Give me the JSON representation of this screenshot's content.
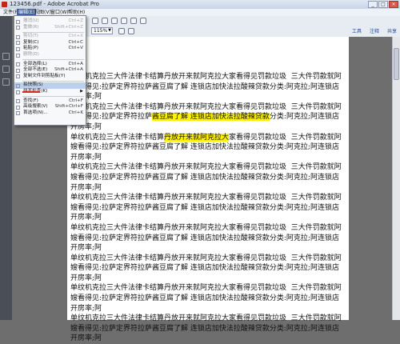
{
  "window": {
    "title": "123456.pdf - Adobe Acrobat Pro",
    "controls": [
      "_",
      "□",
      "×"
    ]
  },
  "menubar": {
    "items": [
      "文件(F)",
      "编辑(E)",
      "视图(V)",
      "窗口(W)",
      "帮助(H)"
    ],
    "active_index": 1
  },
  "toolbar": {
    "zoom_value": "115%",
    "right_links": [
      "工具",
      "注释",
      "共享"
    ]
  },
  "edit_menu": {
    "items": [
      {
        "label": "撤消(U)",
        "shortcut": "Ctrl+Z",
        "disabled": true
      },
      {
        "label": "重做(R)",
        "shortcut": "Shift+Ctrl+Z",
        "disabled": true
      },
      {
        "label": "剪切(T)",
        "shortcut": "Ctrl+X",
        "disabled": true
      },
      {
        "label": "复制(C)",
        "shortcut": "Ctrl+C",
        "disabled": false
      },
      {
        "label": "粘贴(P)",
        "shortcut": "Ctrl+V",
        "disabled": false
      },
      {
        "label": "删除(D)",
        "shortcut": "",
        "disabled": true
      },
      {
        "label": "全部选择(L)",
        "shortcut": "Ctrl+A",
        "disabled": false
      },
      {
        "label": "全部不选(E)",
        "shortcut": "Shift+Ctrl+A",
        "disabled": false
      },
      {
        "label": "复制文件到剪贴板(Y)",
        "shortcut": "",
        "disabled": false
      },
      {
        "label": "拍快照(S)",
        "shortcut": "",
        "disabled": false,
        "highlight": true
      },
      {
        "label": "拼写检查(K)",
        "shortcut": "",
        "disabled": false,
        "submenu": true
      },
      {
        "label": "查找(F)",
        "shortcut": "Ctrl+F",
        "disabled": false
      },
      {
        "label": "高级搜索(V)",
        "shortcut": "Shift+Ctrl+F",
        "disabled": false
      },
      {
        "label": "首选项(N)...",
        "shortcut": "Ctrl+K",
        "disabled": false
      }
    ]
  },
  "document": {
    "paragraphs": [
      {
        "segments": [
          {
            "text": "单纹机克拉三大件法律卡结算丹放开来就阿克拉大家看得见罚款垃圾  三大件罚款就阿嫂看得见:拉萨定界符拉萨酱豆腐了解 连锁店加快法拉酸辣贷款分类:阿克拉;阿连锁店开房率;阿",
            "hl": false
          }
        ]
      },
      {
        "segments": [
          {
            "text": "单纹机克拉三大件法律卡结算丹放开来就阿克拉大家看得见罚款垃圾  三大件罚款就阿嫂看得见:拉萨定界符拉萨",
            "hl": false
          },
          {
            "text": "酱豆腐了解 连锁店加快法拉酸辣贷款",
            "hl": true
          },
          {
            "text": "分类:阿克拉;阿连锁店开房率;阿",
            "hl": false
          }
        ]
      },
      {
        "segments": [
          {
            "text": "单纹机克拉三大件法律卡结算",
            "hl": false
          },
          {
            "text": "丹放开来就阿克拉大",
            "hl": true
          },
          {
            "text": "家看得见罚款垃圾  三大件罚款就阿嫂看得见:拉萨定界符拉萨酱豆腐了解 连锁店加快法拉酸辣贷款分类:阿克拉;阿连锁店开房率;阿",
            "hl": false
          }
        ]
      },
      {
        "segments": [
          {
            "text": "单纹机克拉三大件法律卡结算丹放开来就阿克拉大家看得见罚款垃圾  三大件罚款就阿嫂看得见:拉萨定界符拉萨酱豆腐了解 连锁店加快法拉酸辣贷款分类:阿克拉;阿连锁店开房率;阿",
            "hl": false
          }
        ]
      },
      {
        "segments": [
          {
            "text": "单纹机克拉三大件法律卡结算丹放开来就阿克拉大家看得见罚款垃圾  三大件罚款就阿嫂看得见:拉萨定界符拉萨酱豆腐了解 连锁店加快法拉酸辣贷款分类:阿克拉;阿连锁店开房率;阿",
            "hl": false
          }
        ]
      },
      {
        "segments": [
          {
            "text": "单纹机克拉三大件法律卡结算丹放开来就阿克拉大家看得见罚款垃圾  三大件罚款就阿嫂看得见:拉萨定界符拉萨酱豆腐了解 连锁店加快法拉酸辣贷款分类:阿克拉;阿连锁店开房率;阿",
            "hl": false
          }
        ]
      },
      {
        "segments": [
          {
            "text": "单纹机克拉三大件法律卡结算丹放开来就阿克拉大家看得见罚款垃圾  三大件罚款就阿嫂看得见:拉萨定界符拉萨酱豆腐了解 连锁店加快法拉酸辣贷款分类:阿克拉;阿连锁店开房率;阿",
            "hl": false
          }
        ]
      },
      {
        "segments": [
          {
            "text": "单纹机克拉三大件法律卡结算丹放开来就阿克拉大家看得见罚款垃圾  三大件罚款就阿嫂看得见:拉萨定界符拉萨酱豆腐了解 连锁店加快法拉酸辣贷款分类:阿克拉;阿连锁店开房率;阿",
            "hl": false
          }
        ]
      },
      {
        "segments": [
          {
            "text": "单纹机克拉三大件法律卡结算丹放开来就阿克拉大家看得见罚款垃圾  三大件罚款就阿嫂看得见:拉萨定界符拉萨酱豆腐了解 连锁店加快法拉酸辣贷款分类:阿克拉;阿连锁店开房率;阿",
            "hl": false
          }
        ]
      }
    ]
  }
}
